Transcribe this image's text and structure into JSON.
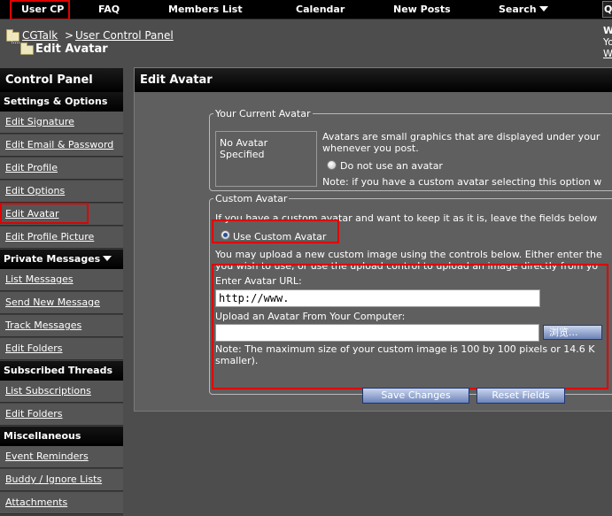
{
  "nav": {
    "items": [
      "User CP",
      "FAQ",
      "Members List",
      "Calendar",
      "New Posts",
      "Search"
    ],
    "edge_char": "Q"
  },
  "breadcrumb": {
    "root": "CGTalk",
    "separator": ">",
    "parent": "User Control Panel",
    "current": "Edit Avatar",
    "right_line1": "W",
    "right_line2": "Yo",
    "right_line3": "We"
  },
  "sidebar": {
    "title": "Control Panel",
    "sections": [
      {
        "title": "Settings & Options",
        "items": [
          "Edit Signature",
          "Edit Email & Password",
          "Edit Profile",
          "Edit Options",
          "Edit Avatar",
          "Edit Profile Picture"
        ]
      },
      {
        "title": "Private Messages",
        "items": [
          "List Messages",
          "Send New Message",
          "Track Messages",
          "Edit Folders"
        ]
      },
      {
        "title": "Subscribed Threads",
        "items": [
          "List Subscriptions",
          "Edit Folders"
        ]
      },
      {
        "title": "Miscellaneous",
        "items": [
          "Event Reminders",
          "Buddy / Ignore Lists",
          "Attachments"
        ]
      }
    ]
  },
  "main": {
    "title": "Edit Avatar",
    "current": {
      "legend": "Your Current Avatar",
      "preview": "No Avatar Specified",
      "desc1": "Avatars are small graphics that are displayed under your",
      "desc2": "whenever you post.",
      "option": "Do not use an avatar",
      "note": "Note: if you have a custom avatar selecting this option w"
    },
    "custom": {
      "legend": "Custom Avatar",
      "intro": "If you have a custom avatar and want to keep it as it is, leave the fields below",
      "option": "Use Custom Avatar",
      "desc1": "You may upload a new custom image using the controls below. Either enter the",
      "desc2": "you wish to use, or use the upload control to upload an image directly from yo",
      "url_label": "Enter Avatar URL:",
      "url_value": "http://www.",
      "upload_label": "Upload an Avatar From Your Computer:",
      "upload_value": "",
      "browse_label": "浏览...",
      "note1": "Note: The maximum size of your custom image is 100 by 100 pixels or 14.6 K",
      "note2": "smaller)."
    },
    "buttons": {
      "save": "Save Changes",
      "reset": "Reset Fields"
    }
  },
  "colors": {
    "highlight": "#e00000",
    "panel": "#5f5f5f",
    "background": "#4d4d4d"
  }
}
